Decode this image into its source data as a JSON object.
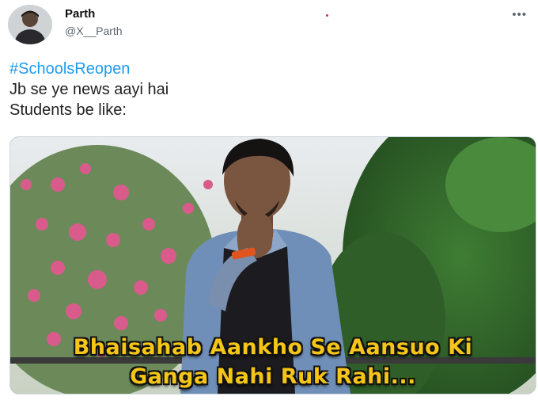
{
  "author": {
    "name": "Parth",
    "handle": "@X__Parth"
  },
  "menu": {
    "more_label": "•••"
  },
  "tweet": {
    "hashtag": "#SchoolsReopen",
    "line1": "Jb se ye news aayi hai",
    "line2": "Students be like:"
  },
  "media": {
    "caption_line1": "Bhaisahab Aankho Se Aansuo Ki",
    "caption_line2": "Ganga Nahi Ruk Rahi..."
  },
  "colors": {
    "hashtag": "#1d9bf0",
    "caption": "#f5c518"
  }
}
